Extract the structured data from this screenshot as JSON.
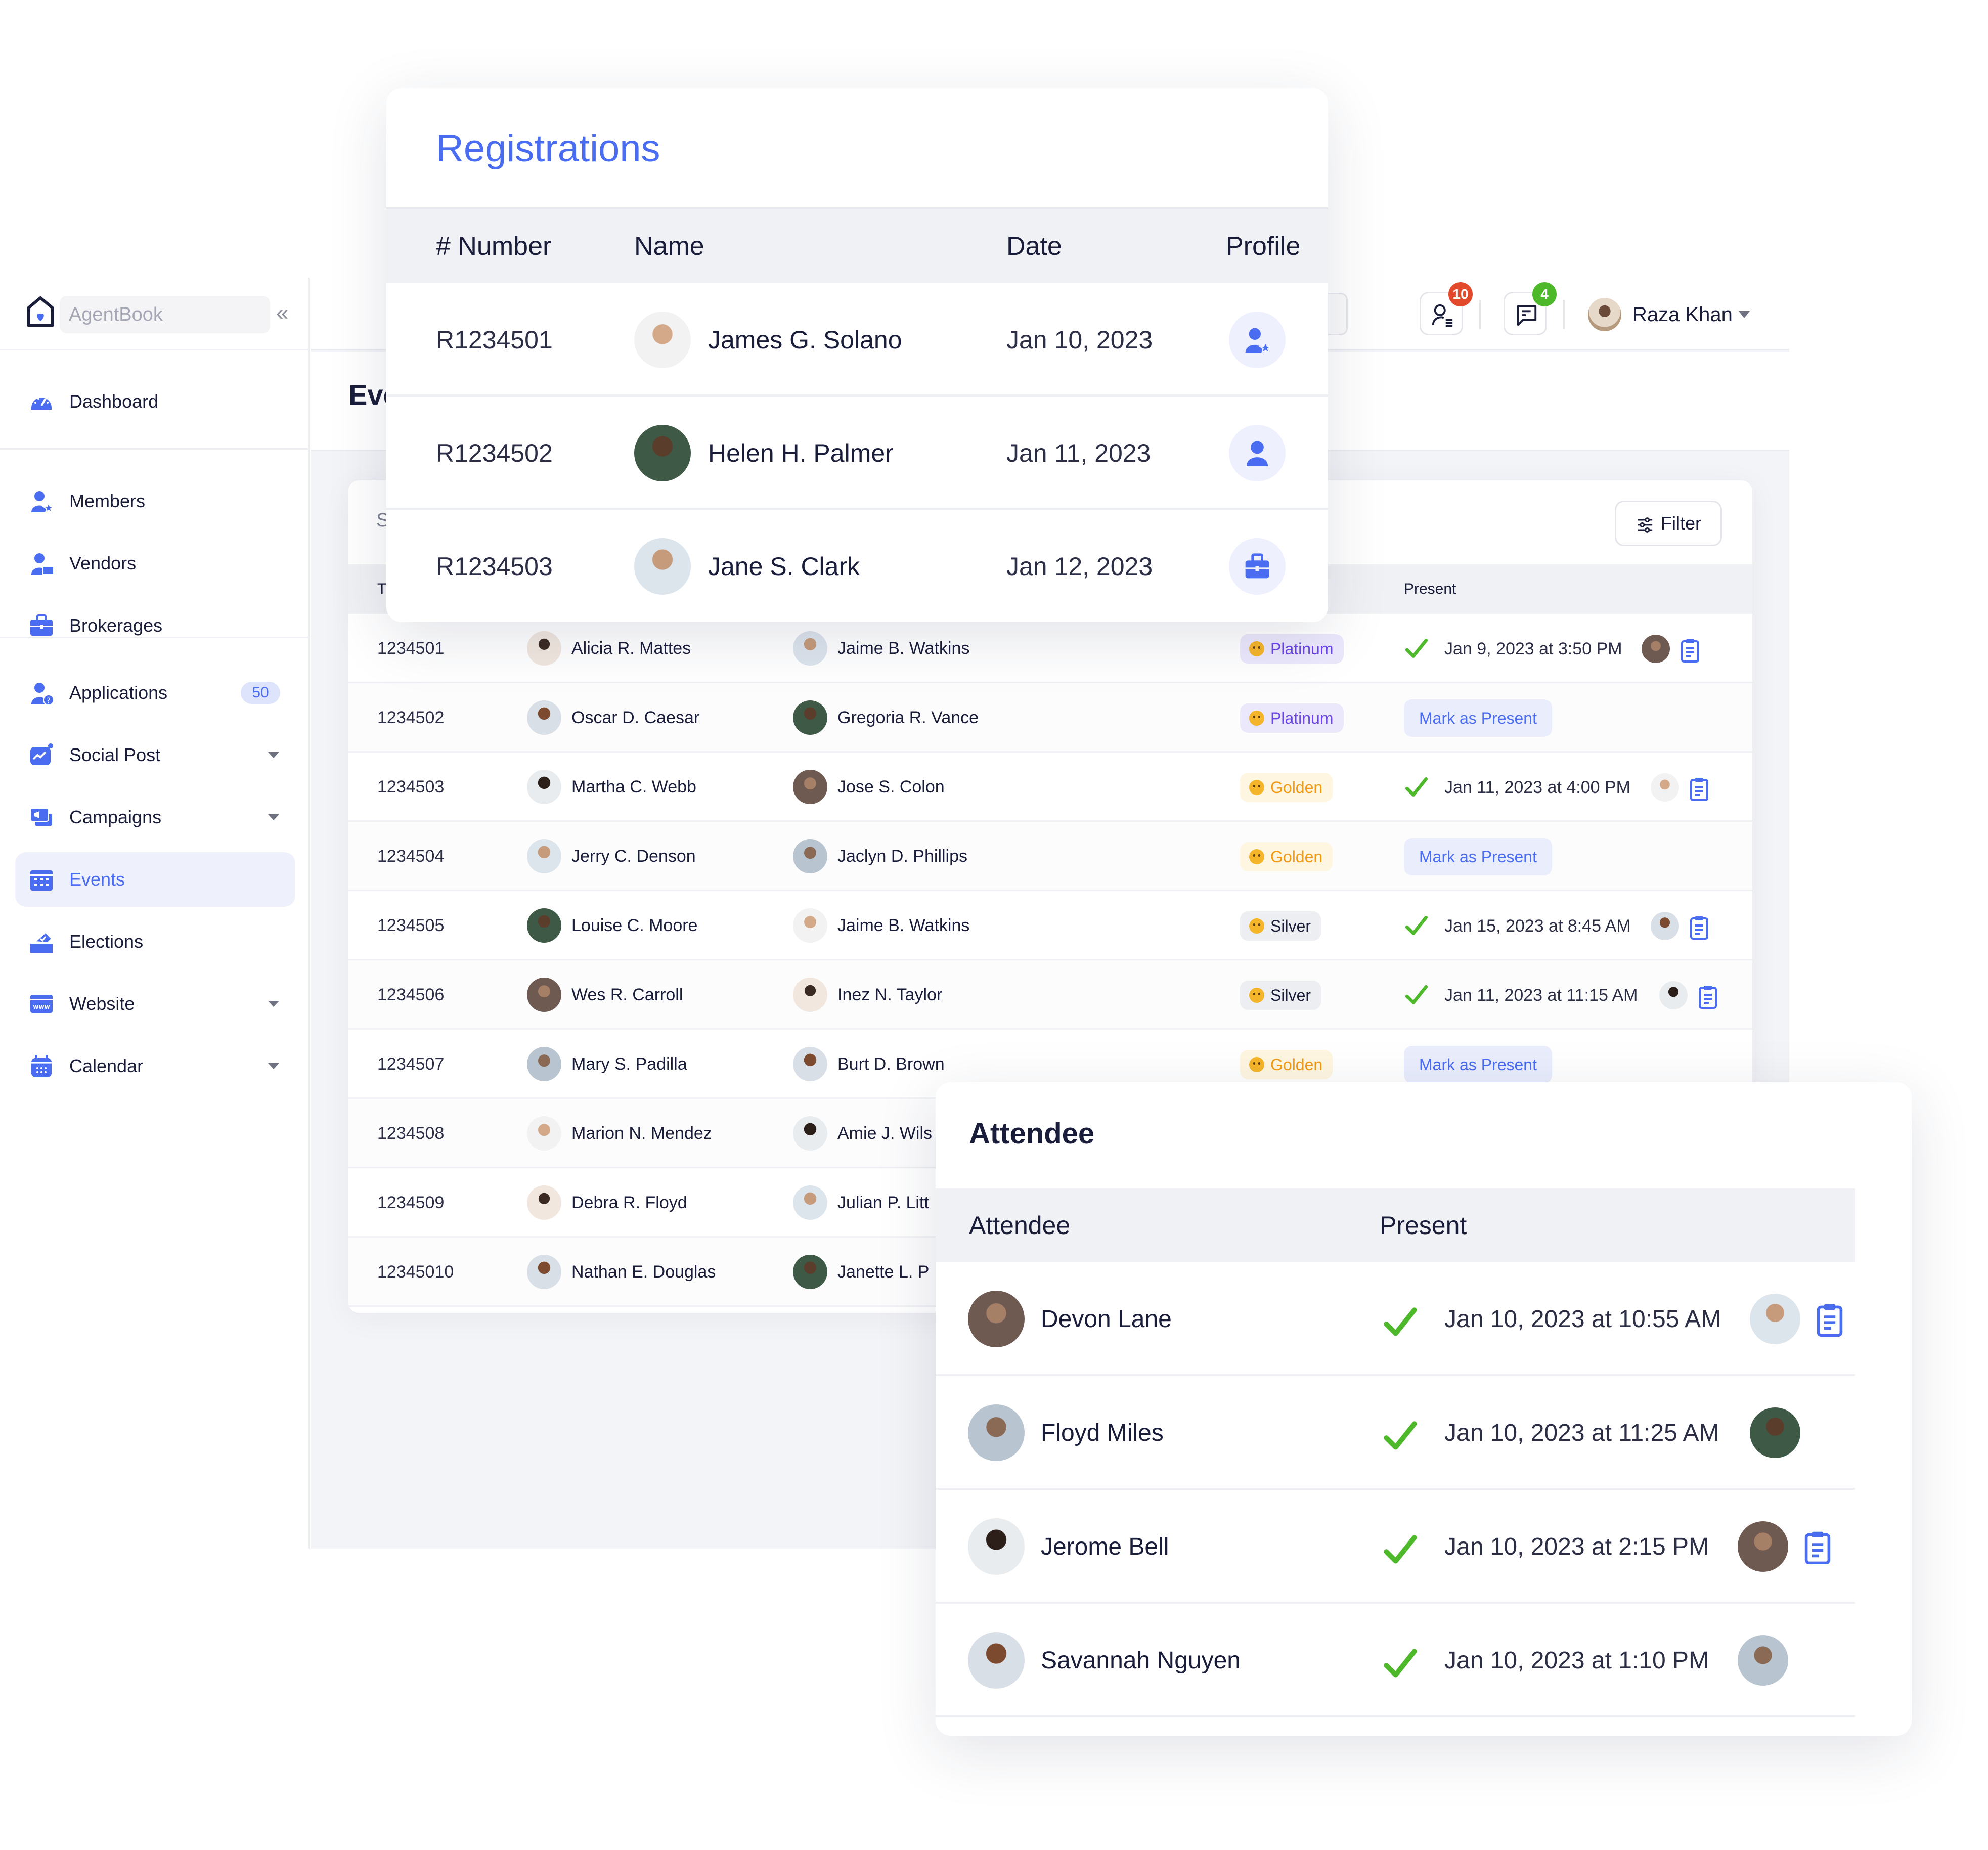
{
  "app": {
    "brand_name": "AgentBook",
    "collapse_glyph": "«",
    "page_title_partial": "Eve",
    "search_partial": "S",
    "col_partial": "T"
  },
  "sidebar": {
    "items": [
      {
        "label": "Dashboard",
        "icon": "dashboard-icon"
      },
      {
        "label": "Members",
        "icon": "members-icon"
      },
      {
        "label": "Vendors",
        "icon": "vendors-icon"
      },
      {
        "label": "Brokerages",
        "icon": "briefcase-icon"
      },
      {
        "label": "Applications",
        "icon": "applications-icon",
        "count": "50"
      },
      {
        "label": "Social Post",
        "icon": "social-post-icon",
        "has_caret": true
      },
      {
        "label": "Campaigns",
        "icon": "campaigns-icon",
        "has_caret": true
      },
      {
        "label": "Events",
        "icon": "calendar-grid-icon",
        "active": true
      },
      {
        "label": "Elections",
        "icon": "ballot-box-icon"
      },
      {
        "label": "Website",
        "icon": "website-icon",
        "has_caret": true
      },
      {
        "label": "Calendar",
        "icon": "calendar-icon",
        "has_caret": true
      }
    ]
  },
  "topbar": {
    "notifications_count": "10",
    "messages_count": "4",
    "user_name": "Raza Khan",
    "badge_colors": {
      "notifications": "#e34a2b",
      "messages": "#4cb82a"
    }
  },
  "events_table": {
    "filter_label": "Filter",
    "present_header": "Present",
    "mark_label": "Mark as Present",
    "rows": [
      {
        "number": "1234501",
        "person1": "Alicia R. Mattes",
        "person2": "Jaime B. Watkins",
        "tier": "Platinum",
        "tier_class": "platinum",
        "present": "Jan 9, 2023 at 3:50 PM"
      },
      {
        "number": "1234502",
        "person1": "Oscar D. Caesar",
        "person2": "Gregoria R. Vance",
        "tier": "Platinum",
        "tier_class": "platinum",
        "present": null
      },
      {
        "number": "1234503",
        "person1": "Martha C. Webb",
        "person2": "Jose S. Colon",
        "tier": "Golden",
        "tier_class": "golden",
        "present": "Jan 11, 2023 at 4:00 PM"
      },
      {
        "number": "1234504",
        "person1": "Jerry C. Denson",
        "person2": "Jaclyn D. Phillips",
        "tier": "Golden",
        "tier_class": "golden",
        "present": null
      },
      {
        "number": "1234505",
        "person1": "Louise C. Moore",
        "person2": "Jaime B. Watkins",
        "tier": "Silver",
        "tier_class": "silver",
        "present": "Jan 15, 2023 at 8:45 AM"
      },
      {
        "number": "1234506",
        "person1": "Wes R. Carroll",
        "person2": "Inez N. Taylor",
        "tier": "Silver",
        "tier_class": "silver",
        "present": "Jan 11, 2023 at 11:15 AM"
      },
      {
        "number": "1234507",
        "person1": "Mary S. Padilla",
        "person2": "Burt D. Brown",
        "tier": "Golden",
        "tier_class": "golden",
        "present": null
      },
      {
        "number": "1234508",
        "person1": "Marion N. Mendez",
        "person2": "Amie J. Wils",
        "tier": null,
        "present": null
      },
      {
        "number": "1234509",
        "person1": "Debra R. Floyd",
        "person2": "Julian P. Litt",
        "tier": null,
        "present": null
      },
      {
        "number": "12345010",
        "person1": "Nathan E. Douglas",
        "person2": "Janette L. P",
        "tier": null,
        "present": null
      }
    ]
  },
  "registrations": {
    "title": "Registrations",
    "headers": [
      "# Number",
      "Name",
      "Date",
      "Profile"
    ],
    "rows": [
      {
        "number": "R1234501",
        "name": "James G. Solano",
        "date": "Jan 10, 2023",
        "profile_icon": "member-star-icon"
      },
      {
        "number": "R1234502",
        "name": "Helen H. Palmer",
        "date": "Jan 11, 2023",
        "profile_icon": "user-icon"
      },
      {
        "number": "R1234503",
        "name": "Jane S. Clark",
        "date": "Jan 12, 2023",
        "profile_icon": "briefcase-icon"
      }
    ]
  },
  "attendee": {
    "title": "Attendee",
    "headers": [
      "Attendee",
      "Present"
    ],
    "rows": [
      {
        "name": "Devon Lane",
        "present": "Jan 10, 2023 at 10:55 AM",
        "has_clipboard": true
      },
      {
        "name": "Floyd Miles",
        "present": "Jan 10, 2023 at 11:25 AM",
        "has_clipboard": false
      },
      {
        "name": "Jerome Bell",
        "present": "Jan 10, 2023 at 2:15 PM",
        "has_clipboard": true
      },
      {
        "name": "Savannah Nguyen",
        "present": "Jan 10, 2023 at 1:10 PM",
        "has_clipboard": false
      }
    ]
  },
  "colors": {
    "accent": "#4a6cf0",
    "check_green": "#4cb82a",
    "text_dark": "#1a1d3a"
  }
}
